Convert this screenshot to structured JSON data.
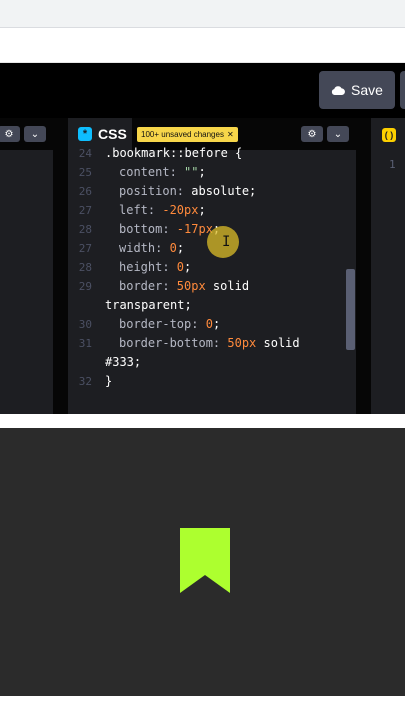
{
  "toolbar": {
    "save_label": "Save"
  },
  "css_pane": {
    "tab_label": "CSS",
    "badge": "*",
    "unsaved_label": "100+ unsaved changes",
    "unsaved_close": "✕",
    "lines": [
      {
        "n": "24",
        "parts": [
          ".bookmark::before {"
        ]
      },
      {
        "n": "25",
        "parts": [
          "content: ",
          "\"\"",
          ";"
        ]
      },
      {
        "n": "26",
        "parts": [
          "position: ",
          "absolute",
          ";"
        ]
      },
      {
        "n": "27",
        "parts": [
          "left: ",
          "-20px",
          ";"
        ]
      },
      {
        "n": "28",
        "parts": [
          "bottom: ",
          "-17px",
          ";"
        ]
      },
      {
        "n": "27",
        "parts": [
          "width: ",
          "0",
          ";"
        ]
      },
      {
        "n": "28",
        "parts": [
          "height: ",
          "0",
          ";"
        ]
      },
      {
        "n": "29",
        "parts": [
          "border: ",
          "50px",
          " solid"
        ]
      },
      {
        "n": "",
        "parts": [
          "transparent;"
        ]
      },
      {
        "n": "30",
        "parts": [
          "border-top: ",
          "0",
          ";"
        ]
      },
      {
        "n": "31",
        "parts": [
          "border-bottom: ",
          "50px",
          " solid"
        ]
      },
      {
        "n": "",
        "parts": [
          "#333;"
        ]
      },
      {
        "n": "32",
        "parts": [
          "}"
        ]
      }
    ]
  },
  "js_pane": {
    "badge": "( )",
    "line_number": "1"
  },
  "icons": {
    "settings": "gear-icon",
    "collapse": "chevron-down-icon",
    "save": "cloud-icon"
  },
  "colors": {
    "accent_css": "#0ebeff",
    "accent_js": "#fcd000",
    "bookmark": "#adff2f",
    "preview_bg": "#2b2b2b"
  }
}
